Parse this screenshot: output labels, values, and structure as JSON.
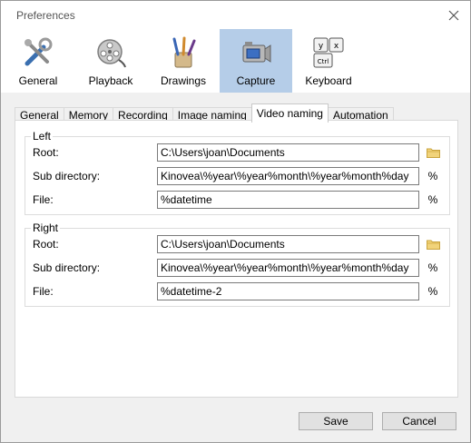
{
  "window": {
    "title": "Preferences"
  },
  "toolbar": {
    "items": [
      {
        "label": "General"
      },
      {
        "label": "Playback"
      },
      {
        "label": "Drawings"
      },
      {
        "label": "Capture"
      },
      {
        "label": "Keyboard"
      }
    ],
    "active": "Capture"
  },
  "tabs": [
    {
      "label": "General"
    },
    {
      "label": "Memory"
    },
    {
      "label": "Recording"
    },
    {
      "label": "Image naming"
    },
    {
      "label": "Video naming"
    },
    {
      "label": "Automation"
    }
  ],
  "active_tab": "Video naming",
  "left": {
    "title": "Left",
    "root_label": "Root:",
    "root_value": "C:\\Users\\joan\\Documents",
    "subdir_label": "Sub directory:",
    "subdir_value": "Kinovea\\%year\\%year%month\\%year%month%day",
    "file_label": "File:",
    "file_value": "%datetime"
  },
  "right": {
    "title": "Right",
    "root_label": "Root:",
    "root_value": "C:\\Users\\joan\\Documents",
    "subdir_label": "Sub directory:",
    "subdir_value": "Kinovea\\%year\\%year%month\\%year%month%day",
    "file_label": "File:",
    "file_value": "%datetime-2"
  },
  "macro_symbol": "%",
  "buttons": {
    "save": "Save",
    "cancel": "Cancel"
  },
  "icons": {
    "general": "tools-icon",
    "playback": "film-reel-icon",
    "drawings": "brushes-icon",
    "capture": "camera-icon",
    "keyboard": "keyboard-keys-icon",
    "folder": "folder-icon",
    "close": "close-icon"
  },
  "colors": {
    "active_toolbar": "#b5cde8",
    "folder": "#e8c35a"
  }
}
